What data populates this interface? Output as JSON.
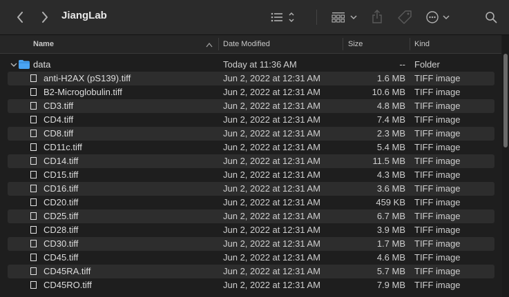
{
  "window": {
    "title": "JiangLab"
  },
  "toolbar": {
    "back_icon": "chevron-left-icon",
    "forward_icon": "chevron-right-icon",
    "list_view_icon": "list-view-icon",
    "group_icon": "grid-group-icon",
    "share_icon": "share-icon",
    "tag_icon": "tag-icon",
    "more_icon": "ellipsis-circle-icon",
    "search_icon": "search-icon"
  },
  "columns": {
    "name": "Name",
    "date": "Date Modified",
    "size": "Size",
    "kind": "Kind"
  },
  "folder": {
    "name": "data",
    "date": "Today at 11:36 AM",
    "size": "--",
    "kind": "Folder"
  },
  "files": [
    {
      "name": "anti-H2AX (pS139).tiff",
      "date": "Jun 2, 2022 at 12:31 AM",
      "size": "1.6 MB",
      "kind": "TIFF image"
    },
    {
      "name": "B2-Microglobulin.tiff",
      "date": "Jun 2, 2022 at 12:31 AM",
      "size": "10.6 MB",
      "kind": "TIFF image"
    },
    {
      "name": "CD3.tiff",
      "date": "Jun 2, 2022 at 12:31 AM",
      "size": "4.8 MB",
      "kind": "TIFF image"
    },
    {
      "name": "CD4.tiff",
      "date": "Jun 2, 2022 at 12:31 AM",
      "size": "7.4 MB",
      "kind": "TIFF image"
    },
    {
      "name": "CD8.tiff",
      "date": "Jun 2, 2022 at 12:31 AM",
      "size": "2.3 MB",
      "kind": "TIFF image"
    },
    {
      "name": "CD11c.tiff",
      "date": "Jun 2, 2022 at 12:31 AM",
      "size": "5.4 MB",
      "kind": "TIFF image"
    },
    {
      "name": "CD14.tiff",
      "date": "Jun 2, 2022 at 12:31 AM",
      "size": "11.5 MB",
      "kind": "TIFF image"
    },
    {
      "name": "CD15.tiff",
      "date": "Jun 2, 2022 at 12:31 AM",
      "size": "4.3 MB",
      "kind": "TIFF image"
    },
    {
      "name": "CD16.tiff",
      "date": "Jun 2, 2022 at 12:31 AM",
      "size": "3.6 MB",
      "kind": "TIFF image"
    },
    {
      "name": "CD20.tiff",
      "date": "Jun 2, 2022 at 12:31 AM",
      "size": "459 KB",
      "kind": "TIFF image"
    },
    {
      "name": "CD25.tiff",
      "date": "Jun 2, 2022 at 12:31 AM",
      "size": "6.7 MB",
      "kind": "TIFF image"
    },
    {
      "name": "CD28.tiff",
      "date": "Jun 2, 2022 at 12:31 AM",
      "size": "3.9 MB",
      "kind": "TIFF image"
    },
    {
      "name": "CD30.tiff",
      "date": "Jun 2, 2022 at 12:31 AM",
      "size": "1.7 MB",
      "kind": "TIFF image"
    },
    {
      "name": "CD45.tiff",
      "date": "Jun 2, 2022 at 12:31 AM",
      "size": "4.6 MB",
      "kind": "TIFF image"
    },
    {
      "name": "CD45RA.tiff",
      "date": "Jun 2, 2022 at 12:31 AM",
      "size": "5.7 MB",
      "kind": "TIFF image"
    },
    {
      "name": "CD45RO.tiff",
      "date": "Jun 2, 2022 at 12:31 AM",
      "size": "7.9 MB",
      "kind": "TIFF image"
    }
  ],
  "colors": {
    "folder": "#4aa4f3",
    "toolbar_bg": "#2b2b2b",
    "row_alt": "#2d2d2d"
  }
}
